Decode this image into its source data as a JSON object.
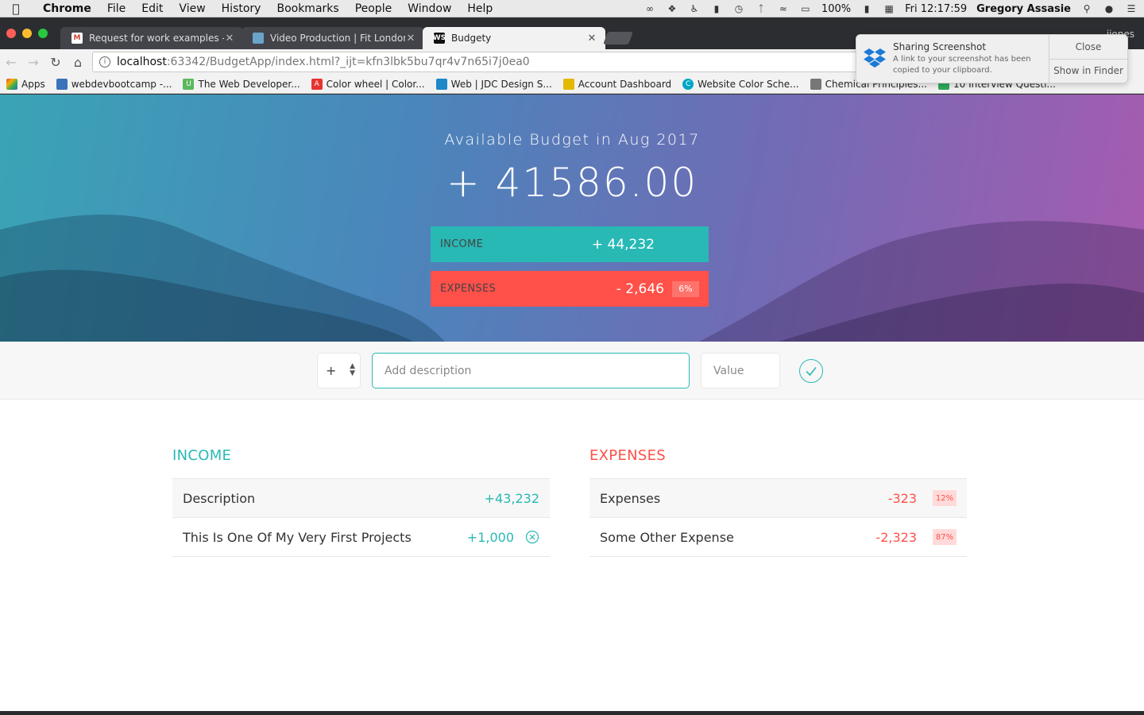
{
  "menubar": {
    "app_name": "Chrome",
    "items": [
      "File",
      "Edit",
      "View",
      "History",
      "Bookmarks",
      "People",
      "Window",
      "Help"
    ],
    "battery": "100%",
    "clock": "Fri 12:17:59",
    "user": "Gregory Assasie"
  },
  "browser": {
    "tabs": [
      {
        "title": "Request for work examples - G",
        "icon": "gmail-icon",
        "color": "#d44638"
      },
      {
        "title": "Video Production | Fit Londone",
        "icon": "site-icon",
        "color": "#6aa4c8"
      },
      {
        "title": "Budgety",
        "icon": "webstorm-icon",
        "color": "#111111"
      }
    ],
    "profile": "jjones",
    "url_host": "localhost",
    "url_path": ":63342/BudgetApp/index.html?_ijt=kfn3lbk5bu7qr4v7n65i7j0ea0",
    "bookmarks": [
      {
        "label": "Apps",
        "color": "#e04a3f"
      },
      {
        "label": "webdevbootcamp -...",
        "color": "#3b73b9"
      },
      {
        "label": "The Web Developer...",
        "color": "#5cb85c"
      },
      {
        "label": "Color wheel | Color...",
        "color": "#e8322f"
      },
      {
        "label": "Web | JDC Design S...",
        "color": "#1e88c8"
      },
      {
        "label": "Account Dashboard",
        "color": "#e5b800"
      },
      {
        "label": "Website Color Sche...",
        "color": "#00a6c7"
      },
      {
        "label": "Chemical Principles...",
        "color": "#777777"
      },
      {
        "label": "10 Interview Questi...",
        "color": "#2eaa5a"
      }
    ]
  },
  "notification": {
    "title": "Sharing Screenshot",
    "body": "A link to your screenshot has been copied to your clipboard.",
    "close_label": "Close",
    "finder_label": "Show in Finder"
  },
  "budget": {
    "title": "Available Budget in Aug 2017",
    "value": "+ 41586.00",
    "income_label": "INCOME",
    "income_value": "+ 44,232",
    "expenses_label": "EXPENSES",
    "expenses_value": "- 2,646",
    "expenses_percentage": "6%"
  },
  "add_form": {
    "type_value": "+",
    "description_placeholder": "Add description",
    "value_placeholder": "Value"
  },
  "income": {
    "title": "INCOME",
    "items": [
      {
        "description": "Description",
        "value": "+43,232"
      },
      {
        "description": "This Is One Of My Very First Projects",
        "value": "+1,000"
      }
    ]
  },
  "expenses": {
    "title": "EXPENSES",
    "items": [
      {
        "description": "Expenses",
        "value": "-323",
        "percentage": "12%"
      },
      {
        "description": "Some Other Expense",
        "value": "-2,323",
        "percentage": "87%"
      }
    ]
  },
  "colors": {
    "income": "#28b9b5",
    "expenses": "#ff5049"
  }
}
